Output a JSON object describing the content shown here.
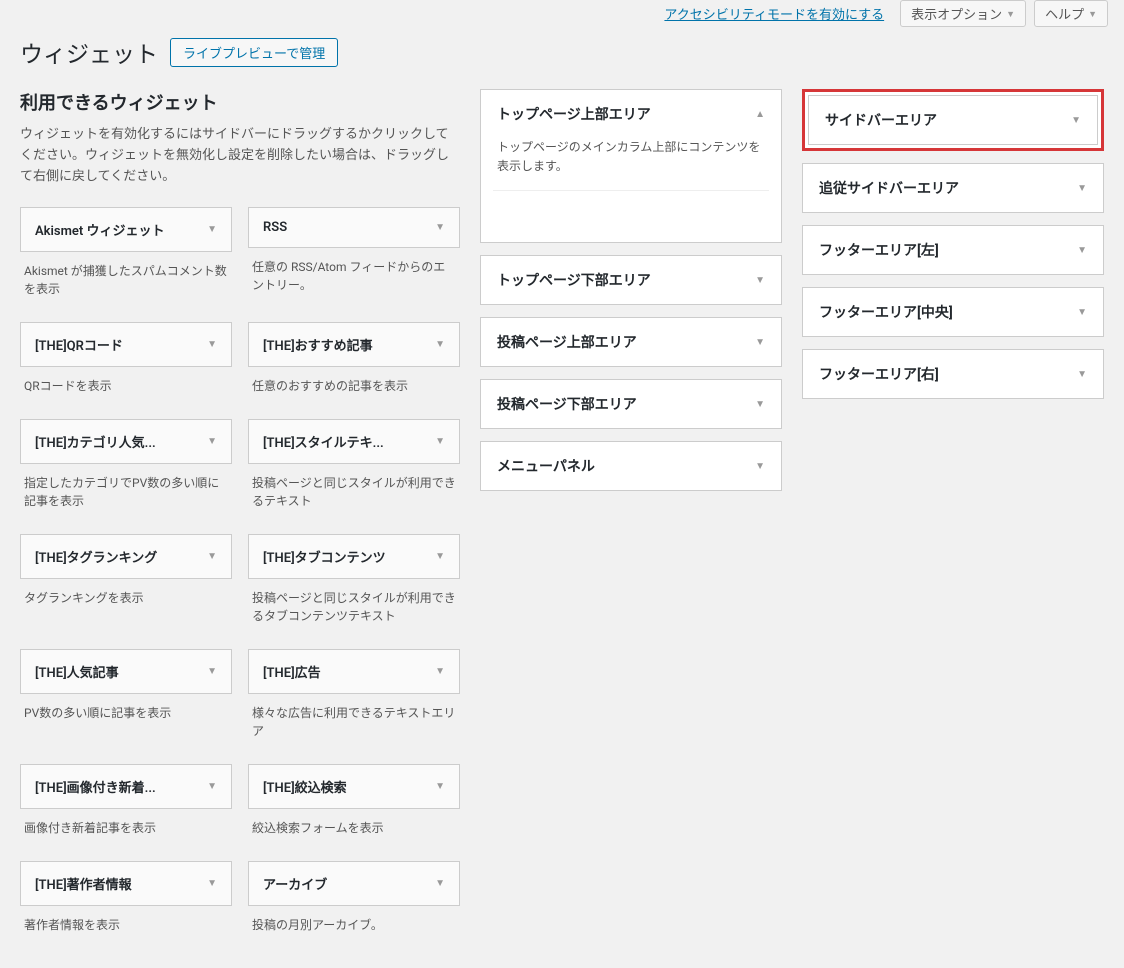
{
  "topbar": {
    "accessibility": "アクセシビリティモードを有効にする",
    "screen_options": "表示オプション",
    "help": "ヘルプ"
  },
  "header": {
    "title": "ウィジェット",
    "live_preview": "ライブプレビューで管理"
  },
  "available": {
    "title": "利用できるウィジェット",
    "desc": "ウィジェットを有効化するにはサイドバーにドラッグするかクリックしてください。ウィジェットを無効化し設定を削除したい場合は、ドラッグして右側に戻してください。"
  },
  "widgets": [
    {
      "title": "Akismet ウィジェット",
      "desc": "Akismet が捕獲したスパムコメント数を表示"
    },
    {
      "title": "RSS",
      "desc": "任意の RSS/Atom フィードからのエントリー。"
    },
    {
      "title": "[THE]QRコード",
      "desc": "QRコードを表示"
    },
    {
      "title": "[THE]おすすめ記事",
      "desc": "任意のおすすめの記事を表示"
    },
    {
      "title": "[THE]カテゴリ人気...",
      "desc": "指定したカテゴリでPV数の多い順に記事を表示"
    },
    {
      "title": "[THE]スタイルテキ...",
      "desc": "投稿ページと同じスタイルが利用できるテキスト"
    },
    {
      "title": "[THE]タグランキング",
      "desc": "タグランキングを表示"
    },
    {
      "title": "[THE]タブコンテンツ",
      "desc": "投稿ページと同じスタイルが利用できるタブコンテンツテキスト"
    },
    {
      "title": "[THE]人気記事",
      "desc": "PV数の多い順に記事を表示"
    },
    {
      "title": "[THE]広告",
      "desc": "様々な広告に利用できるテキストエリア"
    },
    {
      "title": "[THE]画像付き新着...",
      "desc": "画像付き新着記事を表示"
    },
    {
      "title": "[THE]絞込検索",
      "desc": "絞込検索フォームを表示"
    },
    {
      "title": "[THE]著作者情報",
      "desc": "著作者情報を表示"
    },
    {
      "title": "アーカイブ",
      "desc": "投稿の月別アーカイブ。"
    }
  ],
  "areas_mid": [
    {
      "title": "トップページ上部エリア",
      "desc": "トップページのメインカラム上部にコンテンツを表示します。",
      "expanded": true
    },
    {
      "title": "トップページ下部エリア",
      "expanded": false
    },
    {
      "title": "投稿ページ上部エリア",
      "expanded": false
    },
    {
      "title": "投稿ページ下部エリア",
      "expanded": false
    },
    {
      "title": "メニューパネル",
      "expanded": false
    }
  ],
  "areas_right": [
    {
      "title": "サイドバーエリア",
      "highlighted": true
    },
    {
      "title": "追従サイドバーエリア"
    },
    {
      "title": "フッターエリア[左]"
    },
    {
      "title": "フッターエリア[中央]"
    },
    {
      "title": "フッターエリア[右]"
    }
  ]
}
